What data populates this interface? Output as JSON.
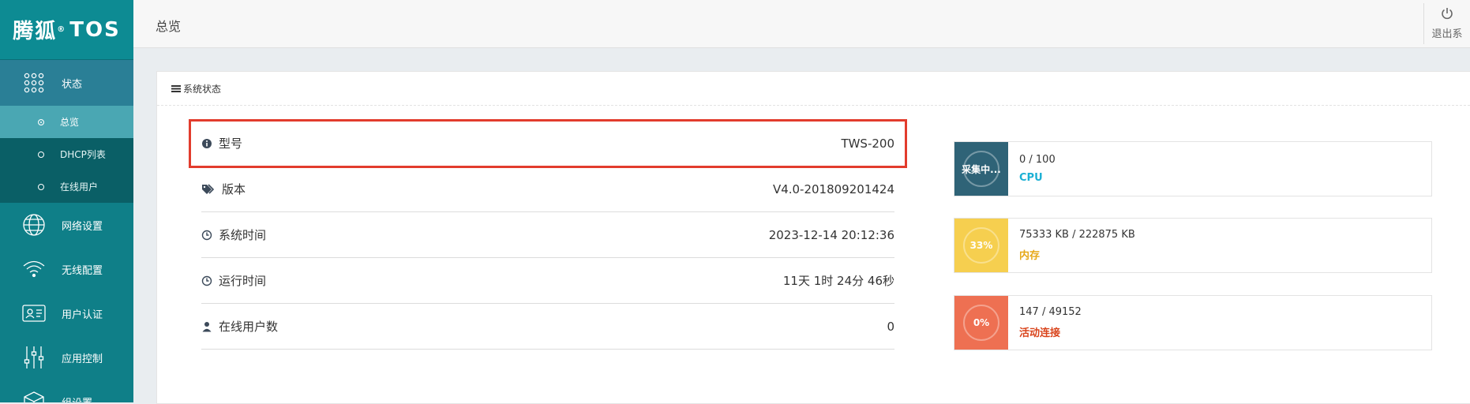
{
  "sidebar": {
    "logo_cn": "腾狐",
    "logo_reg": "®",
    "logo_en": "TOS",
    "items": [
      {
        "label": "状态"
      },
      {
        "label": "网络设置"
      },
      {
        "label": "无线配置"
      },
      {
        "label": "用户认证"
      },
      {
        "label": "应用控制"
      },
      {
        "label": "组设置"
      }
    ],
    "subitems": [
      {
        "label": "总览"
      },
      {
        "label": "DHCP列表"
      },
      {
        "label": "在线用户"
      }
    ]
  },
  "topbar": {
    "title": "总览",
    "logout_label": "退出系"
  },
  "panel": {
    "title": "系统状态"
  },
  "info": {
    "rows": [
      {
        "label": "型号",
        "value": "TWS-200"
      },
      {
        "label": "版本",
        "value": "V4.0-201809201424"
      },
      {
        "label": "系统时间",
        "value": "2023-12-14 20:12:36"
      },
      {
        "label": "运行时间",
        "value": "11天 1时 24分 46秒"
      },
      {
        "label": "在线用户数",
        "value": "0"
      }
    ]
  },
  "stats": [
    {
      "badge": "采集中...",
      "nums": "0 / 100",
      "name": "CPU",
      "color": "#2f6377",
      "name_color": "#1bb0d4"
    },
    {
      "badge": "33%",
      "nums": "75333 KB / 222875 KB",
      "name": "内存",
      "color": "#f6cf4f",
      "name_color": "#e6a817"
    },
    {
      "badge": "0%",
      "nums": "147 / 49152",
      "name": "活动连接",
      "color": "#ee7052",
      "name_color": "#d9441c"
    }
  ]
}
